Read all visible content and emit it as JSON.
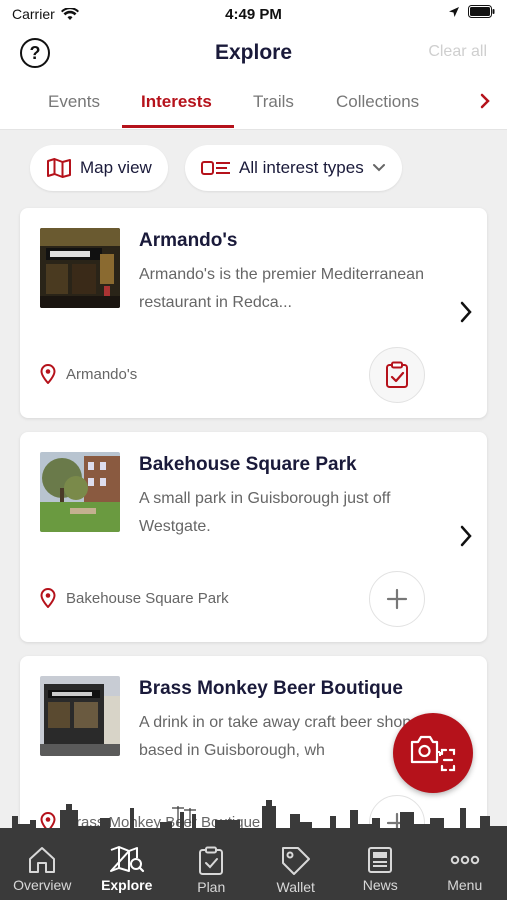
{
  "status": {
    "carrier": "Carrier",
    "time": "4:49 PM"
  },
  "header": {
    "help": "?",
    "title": "Explore",
    "clear_all": "Clear all"
  },
  "tabs": [
    {
      "label": "Events"
    },
    {
      "label": "Interests"
    },
    {
      "label": "Trails"
    },
    {
      "label": "Collections"
    }
  ],
  "filters": {
    "map_view": "Map view",
    "interest_types": "All interest types"
  },
  "cards": [
    {
      "title": "Armando's",
      "description": "Armando's is the premier Mediterranean restaurant in Redca...",
      "location": "Armando's",
      "action": "added-to-plan-icon"
    },
    {
      "title": "Bakehouse Square Park",
      "description": "A small park in Guisborough just off Westgate.",
      "location": "Bakehouse Square Park",
      "action": "add-icon"
    },
    {
      "title": "Brass Monkey Beer Boutique",
      "description": "A drink in or take away craft beer shop based in Guisborough, wh",
      "location": "Brass Monkey Beer Boutique",
      "action": "add-icon"
    }
  ],
  "nav": [
    {
      "label": "Overview"
    },
    {
      "label": "Explore"
    },
    {
      "label": "Plan"
    },
    {
      "label": "Wallet"
    },
    {
      "label": "News"
    },
    {
      "label": "Menu"
    }
  ],
  "colors": {
    "accent": "#b5121b",
    "nav_bg": "#3a3a3a",
    "title": "#1a1a3a"
  }
}
